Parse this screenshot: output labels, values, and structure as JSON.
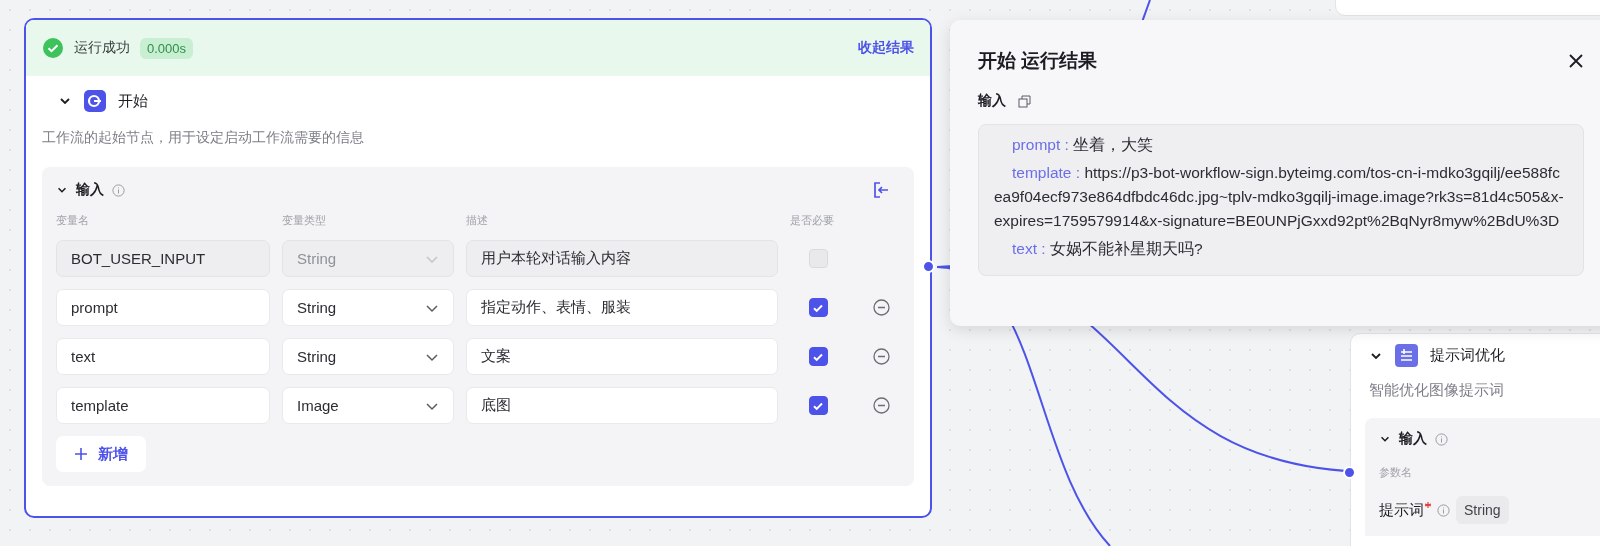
{
  "start_node": {
    "status": {
      "label": "运行成功",
      "time": "0.000s",
      "collapse_link": "收起结果",
      "success": true
    },
    "title": "开始",
    "expanded": true,
    "description": "工作流的起始节点，用于设定启动工作流需要的信息",
    "inputs": {
      "title": "输入",
      "expanded": true,
      "columns": [
        "变量名",
        "变量类型",
        "描述",
        "是否必要"
      ],
      "rows": [
        {
          "name": "BOT_USER_INPUT",
          "type": "String",
          "description": "用户本轮对话输入内容",
          "required": false,
          "disabled": true
        },
        {
          "name": "prompt",
          "type": "String",
          "description": "指定动作、表情、服装",
          "required": true,
          "disabled": false
        },
        {
          "name": "text",
          "type": "String",
          "description": "文案",
          "required": true,
          "disabled": false
        },
        {
          "name": "template",
          "type": "Image",
          "description": "底图",
          "required": true,
          "disabled": false
        }
      ],
      "add_button": "新增"
    }
  },
  "result_panel": {
    "title": "开始 运行结果",
    "section": "输入",
    "entries": [
      {
        "key": "prompt :",
        "value": "坐着，大笑"
      },
      {
        "key": "template :",
        "value": "https://p3-bot-workflow-sign.byteimg.com/tos-cn-i-mdko3gqilj/ee588fcea9f04ecf973e864dfbdc46dc.jpg~tplv-mdko3gqilj-image.image?rk3s=81d4c505&x-expires=1759579914&x-signature=BE0UNPjGxxd92pt%2BqNyr8myw%2BdU%3D"
      },
      {
        "key": "text :",
        "value": "女娲不能补星期天吗?"
      }
    ]
  },
  "prompt_node": {
    "title": "提示词优化",
    "expanded": true,
    "description": "智能优化图像提示词",
    "inputs": {
      "title": "输入",
      "expanded": true,
      "column": "参数名",
      "param": {
        "name": "提示词",
        "required": true,
        "type": "String"
      }
    }
  }
}
